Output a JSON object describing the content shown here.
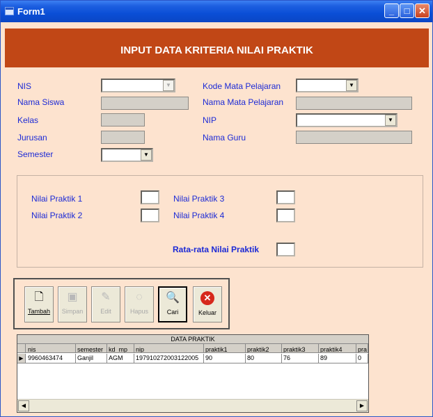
{
  "window": {
    "title": "Form1",
    "icons": [
      "minimize-icon",
      "maximize-icon",
      "close-icon"
    ]
  },
  "header": {
    "title": "INPUT DATA KRITERIA NILAI PRAKTIK"
  },
  "form": {
    "nis": {
      "label": "NIS",
      "value": ""
    },
    "nama_siswa": {
      "label": "Nama Siswa",
      "value": ""
    },
    "kelas": {
      "label": "Kelas",
      "value": ""
    },
    "jurusan": {
      "label": "Jurusan",
      "value": ""
    },
    "semester": {
      "label": "Semester",
      "value": ""
    },
    "kode_mp": {
      "label": "Kode Mata Pelajaran",
      "value": ""
    },
    "nama_mp": {
      "label": "Nama Mata Pelajaran",
      "value": ""
    },
    "nip": {
      "label": "NIP",
      "value": ""
    },
    "nama_guru": {
      "label": "Nama Guru",
      "value": ""
    }
  },
  "scores": {
    "p1": {
      "label": "Nilai Praktik 1",
      "value": ""
    },
    "p2": {
      "label": "Nilai Praktik 2",
      "value": ""
    },
    "p3": {
      "label": "Nilai Praktik 3",
      "value": ""
    },
    "p4": {
      "label": "Nilai Praktik 4",
      "value": ""
    },
    "avg": {
      "label": "Rata-rata Nilai Praktik",
      "value": ""
    }
  },
  "toolbar": {
    "tambah": {
      "label": "Tambah",
      "icon": "new-document-icon",
      "enabled": true
    },
    "simpan": {
      "label": "Simpan",
      "icon": "save-disk-icon",
      "enabled": false
    },
    "edit": {
      "label": "Edit",
      "icon": "edit-pencil-icon",
      "enabled": false
    },
    "hapus": {
      "label": "Hapus",
      "icon": "delete-icon",
      "enabled": false
    },
    "cari": {
      "label": "Cari",
      "icon": "magnifier-icon",
      "enabled": true
    },
    "keluar": {
      "label": "Keluar",
      "icon": "exit-x-icon",
      "enabled": true
    }
  },
  "grid": {
    "caption": "DATA PRAKTIK",
    "columns": [
      "nis",
      "semester",
      "kd_mp",
      "nip",
      "praktik1",
      "praktik2",
      "praktik3",
      "praktik4",
      "pra"
    ],
    "rows": [
      [
        "9960463474",
        "Ganjil",
        "AGM",
        "197910272003122005",
        "90",
        "80",
        "76",
        "89",
        "0"
      ]
    ]
  },
  "colors": {
    "banner": "#c14716",
    "label": "#1c2ad6",
    "form_bg": "#fde3cf",
    "titlebar": "#0a4ed6"
  }
}
